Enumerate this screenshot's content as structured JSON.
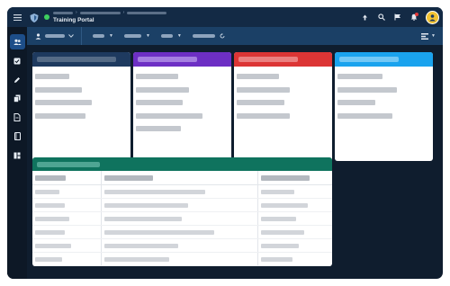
{
  "app": {
    "title": "Training Portal"
  },
  "colors": {
    "topbar": "#132a45",
    "toolbar": "#1b4066",
    "background": "#0f1d2e",
    "card_headers": [
      "#1e3a5f",
      "#6d2fc4",
      "#dc3535",
      "#1aa3ee"
    ],
    "table_header": "#0f735e",
    "status_dot": "#3ecf5f"
  },
  "topbar": {
    "menu_icon": "hamburger-icon",
    "logo_icon": "shield-logo-icon",
    "icons": [
      "upload-icon",
      "search-icon",
      "flag-icon",
      "bell-icon",
      "avatar"
    ]
  },
  "sidebar": {
    "items": [
      {
        "icon": "users-icon",
        "active": true
      },
      {
        "icon": "checkbox-icon",
        "active": false
      },
      {
        "icon": "pencil-icon",
        "active": false
      },
      {
        "icon": "copy-document-icon",
        "active": false
      },
      {
        "icon": "document-icon",
        "active": false
      },
      {
        "icon": "book-icon",
        "active": false
      },
      {
        "icon": "dashboard-icon",
        "active": false
      }
    ]
  },
  "toolbar": {
    "user_icon": "user-icon",
    "filter_icons": [
      "chevron-down-icon",
      "chevron-down-icon",
      "chevron-down-icon",
      "refresh-icon"
    ],
    "right_icon": "layout-toggle-icon"
  }
}
